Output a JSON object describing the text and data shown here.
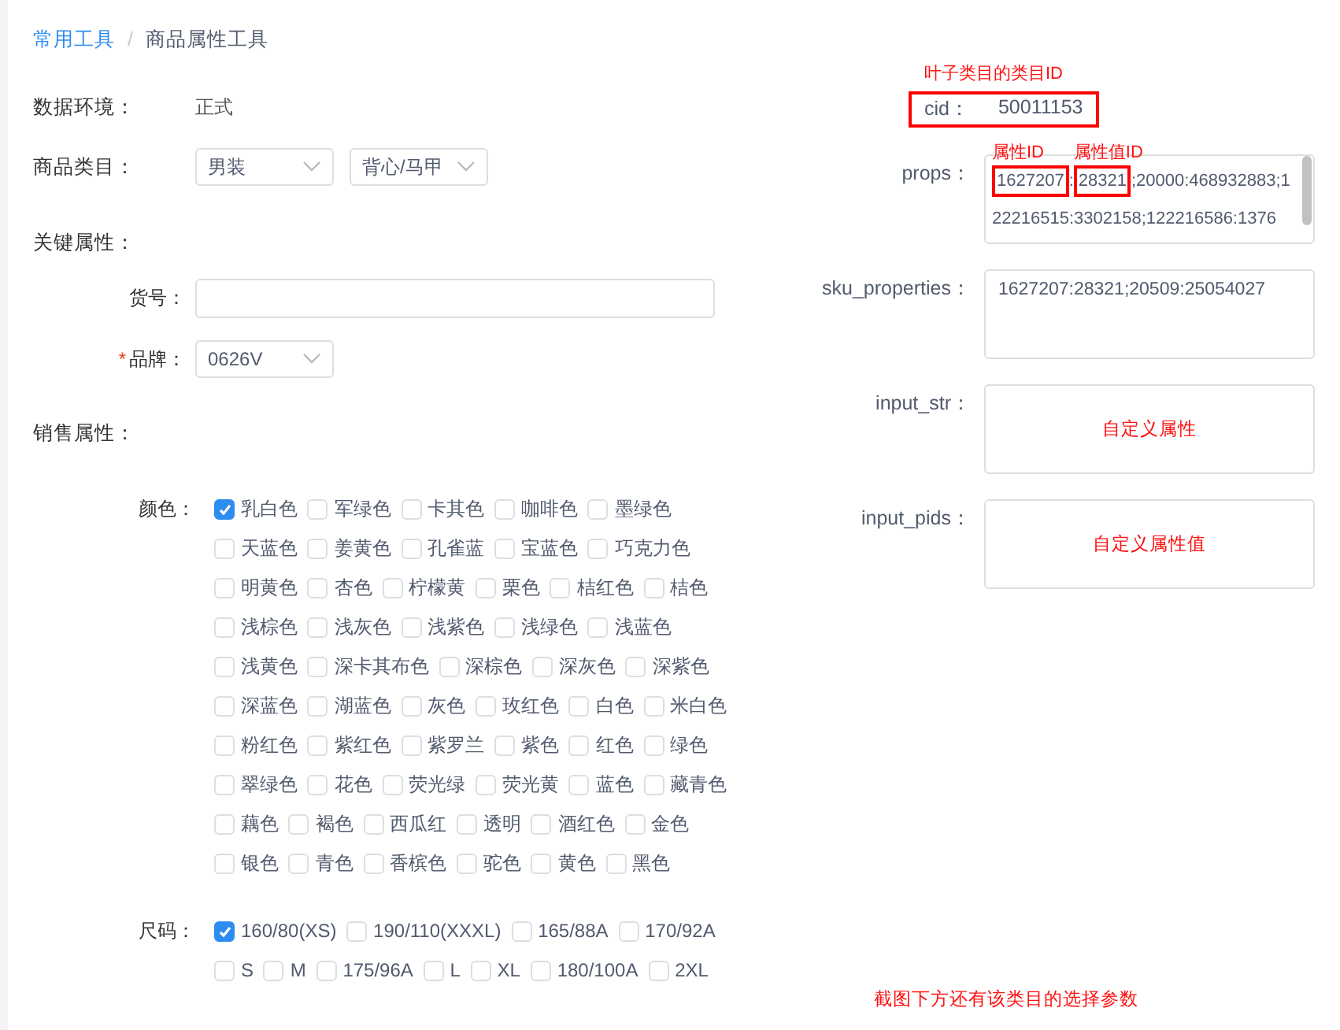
{
  "breadcrumb": {
    "items": [
      {
        "label": "常用工具",
        "link": true
      },
      {
        "label": "商品属性工具",
        "link": false
      }
    ],
    "separator": "/"
  },
  "environment": {
    "label": "数据环境：",
    "value": "正式"
  },
  "category": {
    "label": "商品类目：",
    "selects": [
      "男装",
      "背心/马甲"
    ]
  },
  "key_props": {
    "heading": "关键属性：",
    "fields": [
      {
        "kind": "input",
        "label": "货号："
      },
      {
        "kind": "select",
        "label": "品牌：",
        "required_mark": "*",
        "value": "0626V"
      }
    ]
  },
  "sale_props": {
    "heading": "销售属性：",
    "groups": [
      {
        "label": "颜色：",
        "options": [
          {
            "label": "乳白色",
            "checked": true
          },
          {
            "label": "军绿色",
            "checked": false
          },
          {
            "label": "卡其色",
            "checked": false
          },
          {
            "label": "咖啡色",
            "checked": false
          },
          {
            "label": "墨绿色",
            "checked": false
          },
          {
            "label": "天蓝色",
            "checked": false
          },
          {
            "label": "姜黄色",
            "checked": false
          },
          {
            "label": "孔雀蓝",
            "checked": false
          },
          {
            "label": "宝蓝色",
            "checked": false
          },
          {
            "label": "巧克力色",
            "checked": false
          },
          {
            "label": "明黄色",
            "checked": false
          },
          {
            "label": "杏色",
            "checked": false
          },
          {
            "label": "柠檬黄",
            "checked": false
          },
          {
            "label": "栗色",
            "checked": false
          },
          {
            "label": "桔红色",
            "checked": false
          },
          {
            "label": "桔色",
            "checked": false
          },
          {
            "label": "浅棕色",
            "checked": false
          },
          {
            "label": "浅灰色",
            "checked": false
          },
          {
            "label": "浅紫色",
            "checked": false
          },
          {
            "label": "浅绿色",
            "checked": false
          },
          {
            "label": "浅蓝色",
            "checked": false
          },
          {
            "label": "浅黄色",
            "checked": false
          },
          {
            "label": "深卡其布色",
            "checked": false
          },
          {
            "label": "深棕色",
            "checked": false
          },
          {
            "label": "深灰色",
            "checked": false
          },
          {
            "label": "深紫色",
            "checked": false
          },
          {
            "label": "深蓝色",
            "checked": false
          },
          {
            "label": "湖蓝色",
            "checked": false
          },
          {
            "label": "灰色",
            "checked": false
          },
          {
            "label": "玫红色",
            "checked": false
          },
          {
            "label": "白色",
            "checked": false
          },
          {
            "label": "米白色",
            "checked": false
          },
          {
            "label": "粉红色",
            "checked": false
          },
          {
            "label": "紫红色",
            "checked": false
          },
          {
            "label": "紫罗兰",
            "checked": false
          },
          {
            "label": "紫色",
            "checked": false
          },
          {
            "label": "红色",
            "checked": false
          },
          {
            "label": "绿色",
            "checked": false
          },
          {
            "label": "翠绿色",
            "checked": false
          },
          {
            "label": "花色",
            "checked": false
          },
          {
            "label": "荧光绿",
            "checked": false
          },
          {
            "label": "荧光黄",
            "checked": false
          },
          {
            "label": "蓝色",
            "checked": false
          },
          {
            "label": "藏青色",
            "checked": false
          },
          {
            "label": "藕色",
            "checked": false
          },
          {
            "label": "褐色",
            "checked": false
          },
          {
            "label": "西瓜红",
            "checked": false
          },
          {
            "label": "透明",
            "checked": false
          },
          {
            "label": "酒红色",
            "checked": false
          },
          {
            "label": "金色",
            "checked": false
          },
          {
            "label": "银色",
            "checked": false
          },
          {
            "label": "青色",
            "checked": false
          },
          {
            "label": "香槟色",
            "checked": false
          },
          {
            "label": "驼色",
            "checked": false
          },
          {
            "label": "黄色",
            "checked": false
          },
          {
            "label": "黑色",
            "checked": false
          }
        ]
      },
      {
        "label": "尺码：",
        "options": [
          {
            "label": "160/80(XS)",
            "checked": true
          },
          {
            "label": "190/110(XXXL)",
            "checked": false
          },
          {
            "label": "165/88A",
            "checked": false
          },
          {
            "label": "170/92A",
            "checked": false
          },
          {
            "label": "S",
            "checked": false
          },
          {
            "label": "M",
            "checked": false
          },
          {
            "label": "175/96A",
            "checked": false
          },
          {
            "label": "L",
            "checked": false
          },
          {
            "label": "XL",
            "checked": false
          },
          {
            "label": "180/100A",
            "checked": false
          },
          {
            "label": "2XL",
            "checked": false
          }
        ]
      }
    ]
  },
  "cid": {
    "note": "叶子类目的类目ID",
    "label": "cid：",
    "value": "50011153"
  },
  "props": {
    "label": "props：",
    "lines": [
      [
        {
          "text": "1627207",
          "highlighted": true,
          "note": "属性ID"
        },
        {
          "text": ":",
          "highlighted": false
        },
        {
          "text": "28321",
          "highlighted": true,
          "note": "属性值ID"
        },
        {
          "text": ";20000:468932883;1",
          "highlighted": false
        }
      ],
      [
        {
          "text": "22216515:3302158;122216586:1376",
          "highlighted": false
        }
      ]
    ]
  },
  "sku_properties": {
    "label": "sku_properties：",
    "value": "1627207:28321;20509:25054027"
  },
  "custom_fields": [
    {
      "label": "input_str：",
      "note": "自定义属性"
    },
    {
      "label": "input_pids：",
      "note": "自定义属性值"
    }
  ],
  "footer_note": "截图下方还有该类目的选择参数"
}
